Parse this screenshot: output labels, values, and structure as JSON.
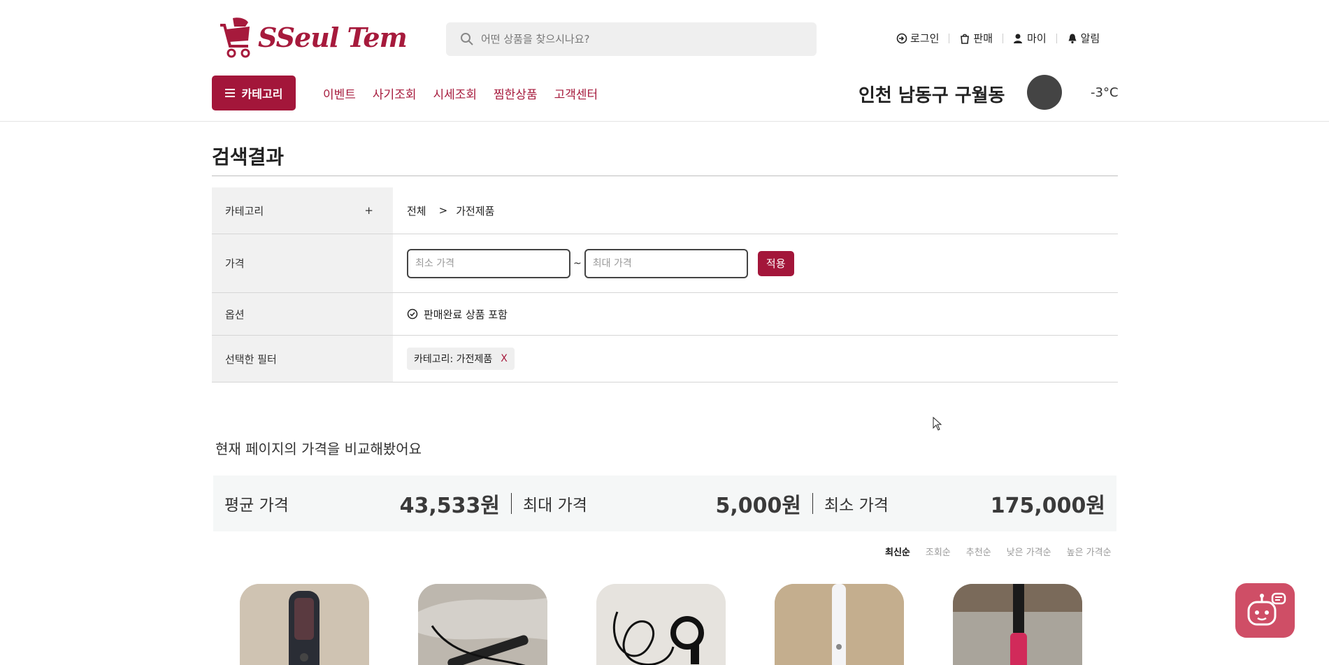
{
  "header": {
    "logo_text": "SSeul Tem",
    "search_placeholder": "어떤 상품을 찾으시나요?",
    "util": [
      "로그인",
      "판매",
      "마이",
      "알림"
    ],
    "category_button": "카테고리",
    "nav": [
      "이벤트",
      "사기조회",
      "시세조회",
      "찜한상품",
      "고객센터"
    ],
    "location": "인천 남동구 구월동",
    "temperature": "-3°C"
  },
  "page_title": "검색결과",
  "filter": {
    "category_label": "카테고리",
    "category_toggle": "+",
    "breadcrumb_all": "전체",
    "breadcrumb_sep": ">",
    "breadcrumb_current": "가전제품",
    "price_label": "가격",
    "min_placeholder": "최소 가격",
    "tilde": "~",
    "max_placeholder": "최대 가격",
    "apply": "적용",
    "option_label": "옵션",
    "option_sold": "판매완료 상품 포함",
    "selected_label": "선택한 필터",
    "chip": "카테고리: 가전제품",
    "chip_remove": "X"
  },
  "compare": {
    "title": "현재 페이지의 가격을 비교해봤어요",
    "avg_label": "평균 가격",
    "avg_value": "43,533원",
    "max_label": "최대 가격",
    "max_value": "5,000원",
    "min_label": "최소 가격",
    "min_value": "175,000원"
  },
  "sort": [
    "최신순",
    "조회순",
    "추천순",
    "낮은 가격순",
    "높은 가격순"
  ],
  "colors": {
    "brand": "#a3163a",
    "chatbot": "#cf4e66"
  },
  "icons": [
    "search-icon",
    "login-icon",
    "sell-icon",
    "user-icon",
    "bell-icon",
    "menu-icon",
    "check-circle-icon",
    "chatbot-icon"
  ]
}
